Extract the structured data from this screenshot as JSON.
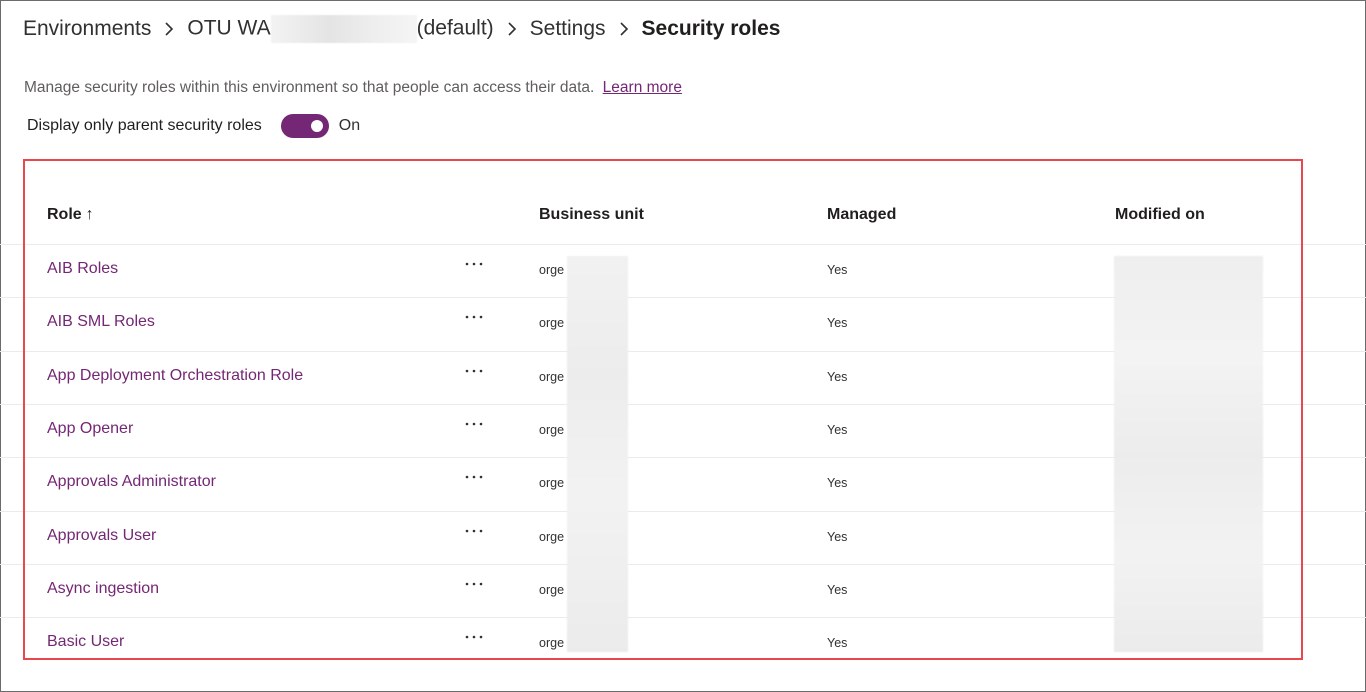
{
  "breadcrumb": {
    "environments": "Environments",
    "environment_prefix": "OTU WA",
    "environment_suffix": "(default)",
    "settings": "Settings",
    "current": "Security roles"
  },
  "description": {
    "text": "Manage security roles within this environment so that people can access their data.",
    "link": "Learn more"
  },
  "toggle": {
    "label": "Display only parent security roles",
    "state": "On"
  },
  "table": {
    "columns": {
      "role": "Role",
      "role_sort": "↑",
      "business_unit": "Business unit",
      "managed": "Managed",
      "modified_on": "Modified on"
    },
    "rows": [
      {
        "role": "AIB Roles",
        "business_unit": "orge",
        "managed": "Yes"
      },
      {
        "role": "AIB SML Roles",
        "business_unit": "orge",
        "managed": "Yes"
      },
      {
        "role": "App Deployment Orchestration Role",
        "business_unit": "orge",
        "managed": "Yes"
      },
      {
        "role": "App Opener",
        "business_unit": "orge",
        "managed": "Yes"
      },
      {
        "role": "Approvals Administrator",
        "business_unit": "orge",
        "managed": "Yes"
      },
      {
        "role": "Approvals User",
        "business_unit": "orge",
        "managed": "Yes"
      },
      {
        "role": "Async ingestion",
        "business_unit": "orge",
        "managed": "Yes"
      },
      {
        "role": "Basic User",
        "business_unit": "orge",
        "managed": "Yes"
      }
    ]
  },
  "colors": {
    "accent": "#742774",
    "highlight_border": "#e8474c",
    "text": "#323130",
    "divider": "#edebe9"
  }
}
